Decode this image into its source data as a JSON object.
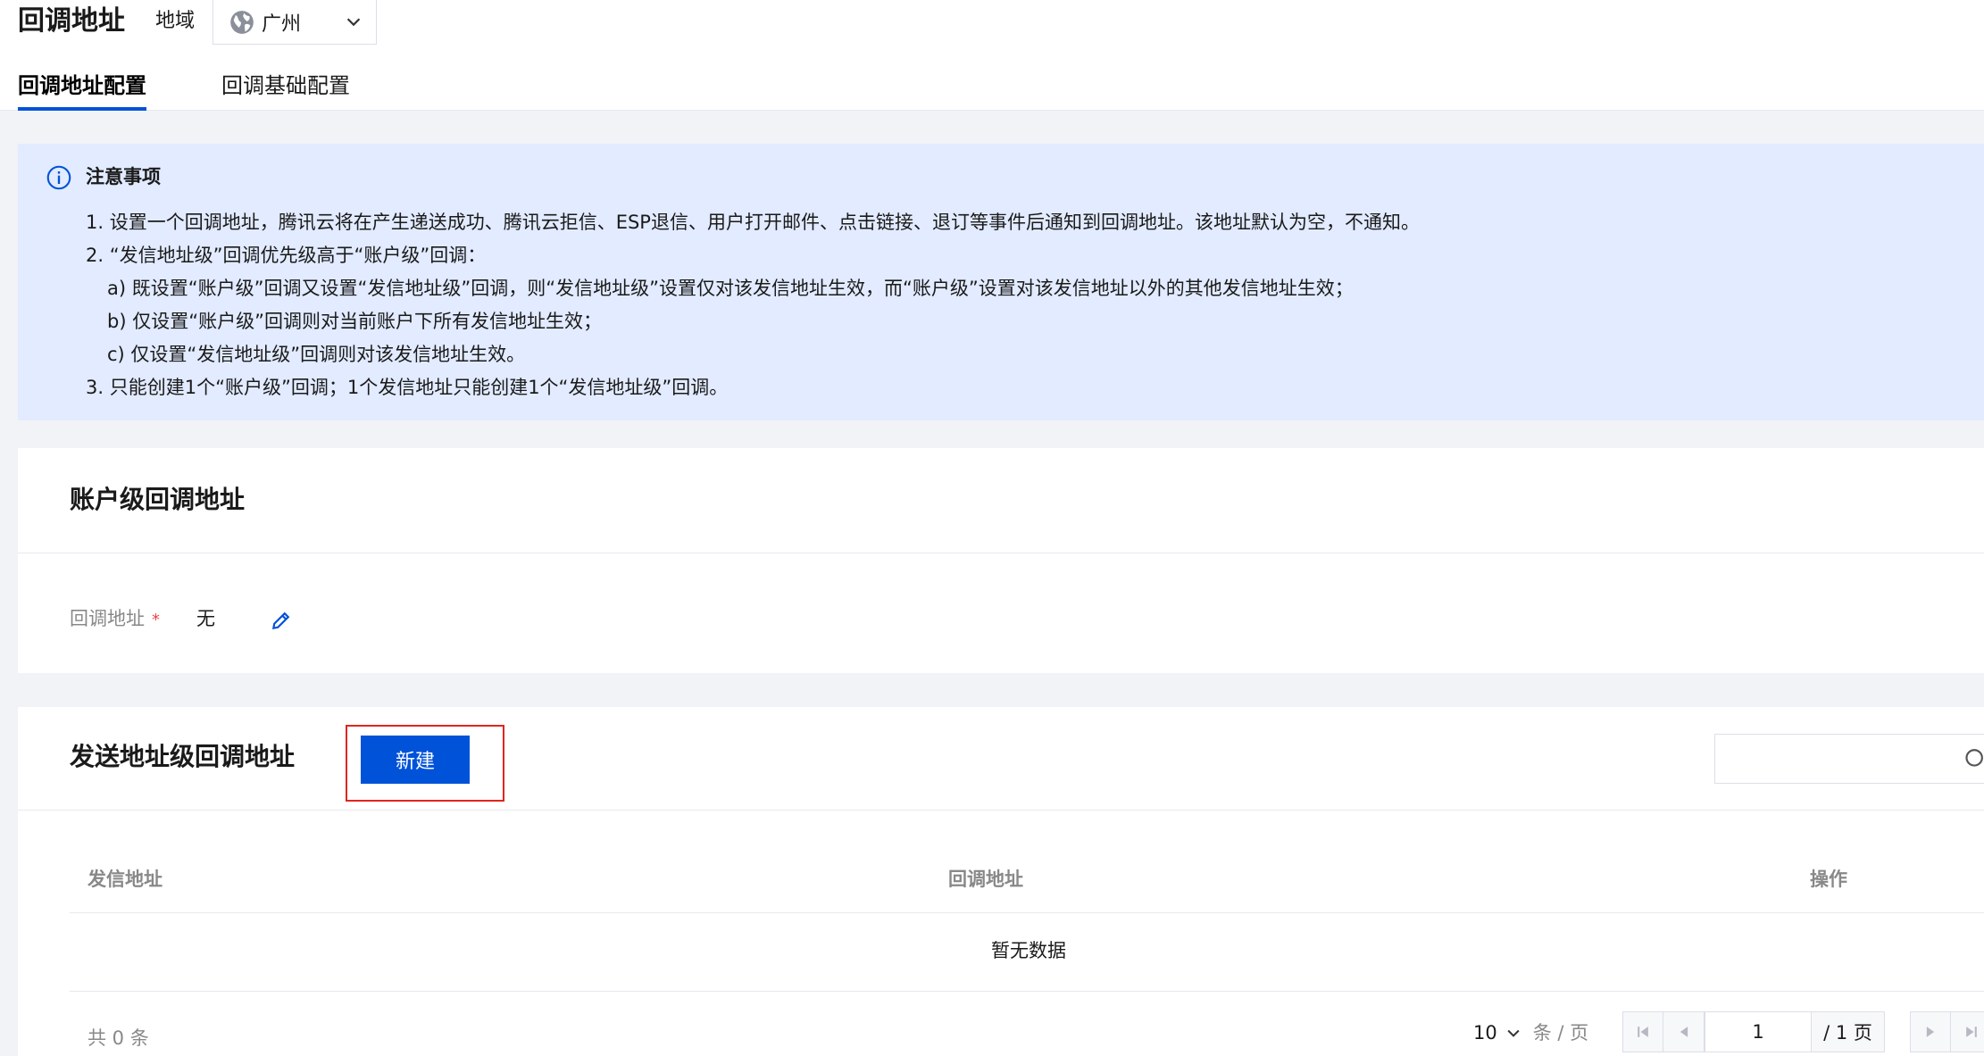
{
  "header": {
    "title": "回调地址",
    "region_label": "地域",
    "region_value": "广州"
  },
  "tabs": [
    {
      "label": "回调地址配置",
      "active": true
    },
    {
      "label": "回调基础配置",
      "active": false
    }
  ],
  "notice": {
    "title": "注意事项",
    "lines": [
      "1. 设置一个回调地址，腾讯云将在产生递送成功、腾讯云拒信、ESP退信、用户打开邮件、点击链接、退订等事件后通知到回调地址。该地址默认为空，不通知。",
      "2. “发信地址级”回调优先级高于“账户级”回调：",
      "a) 既设置“账户级”回调又设置“发信地址级”回调，则“发信地址级”设置仅对该发信地址生效，而“账户级”设置对该发信地址以外的其他发信地址生效；",
      "b) 仅设置“账户级”回调则对当前账户下所有发信地址生效；",
      "c) 仅设置“发信地址级”回调则对该发信地址生效。",
      "3. 只能创建1个“账户级”回调；1个发信地址只能创建1个“发信地址级”回调。"
    ]
  },
  "account_section": {
    "title": "账户级回调地址",
    "field_label": "回调地址",
    "required_mark": "*",
    "field_value": "无"
  },
  "sender_section": {
    "title": "发送地址级回调地址",
    "new_button": "新建",
    "columns": [
      "发信地址",
      "回调地址",
      "操作"
    ],
    "empty_text": "暂无数据"
  },
  "pagination": {
    "total": "共 0 条",
    "page_size": "10",
    "page_size_unit": "条 / 页",
    "current_page": "1",
    "total_pages": "/ 1 页"
  },
  "colors": {
    "primary": "#0052d9",
    "notice_bg": "#e2ebff",
    "highlight_border": "#e0251f",
    "required": "#e54545"
  }
}
